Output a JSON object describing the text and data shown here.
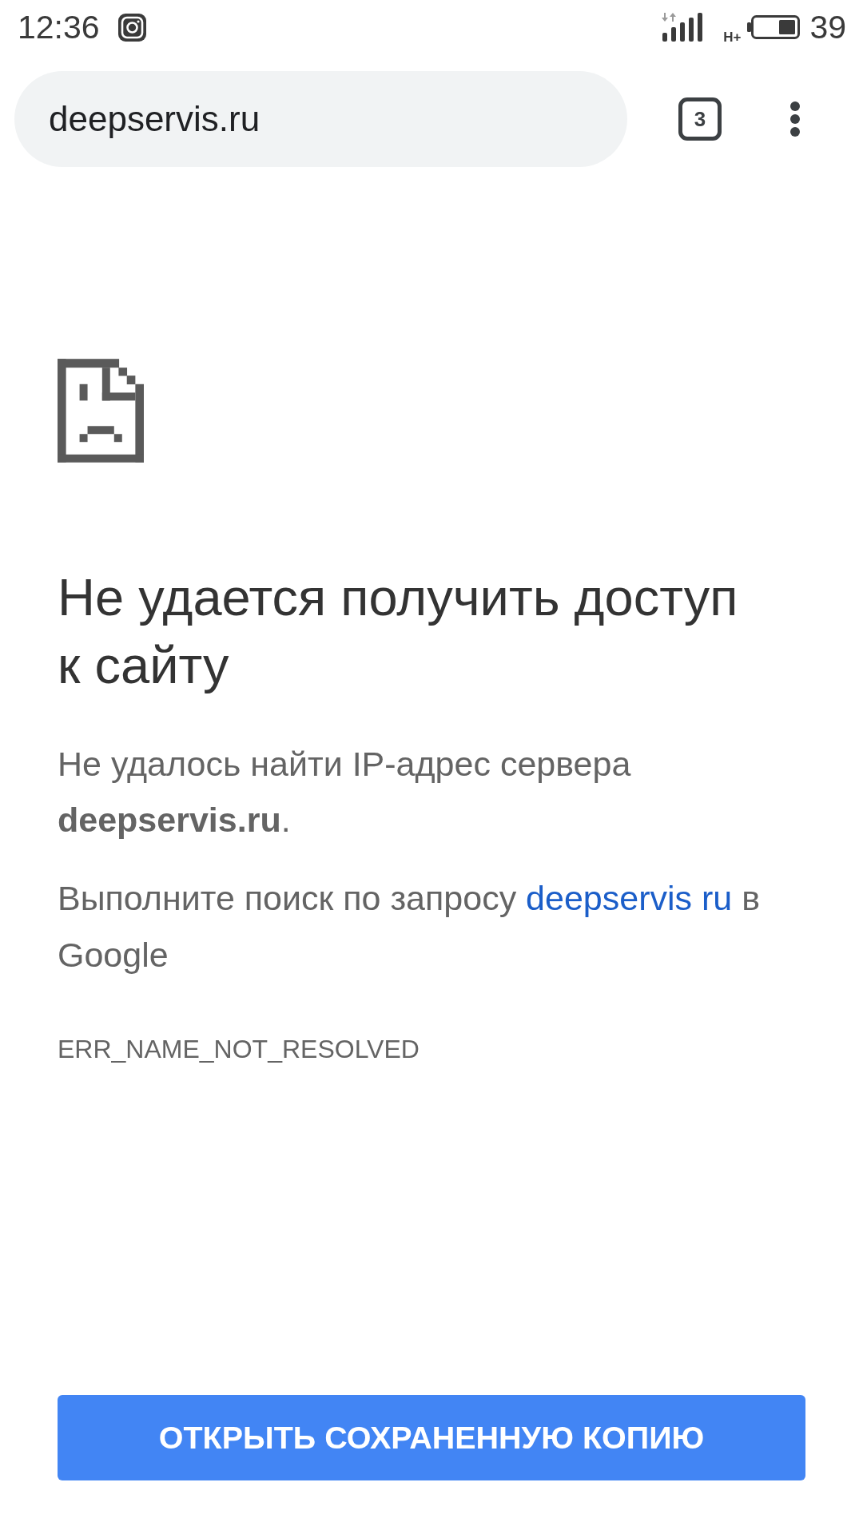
{
  "status_bar": {
    "time": "12:36",
    "network_type": "H+",
    "battery": "39"
  },
  "toolbar": {
    "url": "deepservis.ru",
    "tab_count": "3"
  },
  "error": {
    "title": "Не удается получить доступ к сайту",
    "message": "Не удалось найти IP-адрес сервера **deepservis.ru**.",
    "search": {
      "before": "Выполните поиск по запросу",
      "link": "deepservis ru",
      "after": "в Google"
    },
    "code": "ERR_NAME_NOT_RESOLVED"
  },
  "button": {
    "label": "ОТКРЫТЬ СОХРАНЕННУЮ КОПИЮ"
  }
}
